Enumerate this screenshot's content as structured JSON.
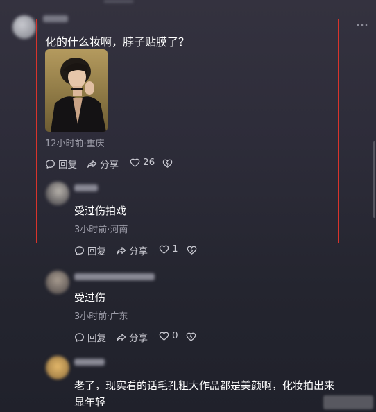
{
  "main_comment": {
    "text": "化的什么妆啊，脖子贴膜了？",
    "meta": "12小时前·重庆",
    "reply_label": "回复",
    "share_label": "分享",
    "like_count": "26"
  },
  "replies": [
    {
      "text": "受过伤拍戏",
      "meta": "3小时前·河南",
      "reply_label": "回复",
      "share_label": "分享",
      "like_count": "1"
    },
    {
      "text": "受过伤",
      "meta": "3小时前·广东",
      "reply_label": "回复",
      "share_label": "分享",
      "like_count": "0"
    },
    {
      "text_line1": "老了，现实看的话毛孔粗大作品都是美颜啊，化妆拍出来",
      "text_line2": "显年轻"
    }
  ],
  "icons": {
    "reply": "comment-bubble-icon",
    "share": "share-arrow-icon",
    "like": "heart-icon",
    "dislike": "broken-heart-icon",
    "more": "more-dots-icon"
  },
  "colors": {
    "highlight_box": "#d8342c",
    "text_primary": "#ffffff",
    "text_secondary": "#9c9ca8"
  }
}
